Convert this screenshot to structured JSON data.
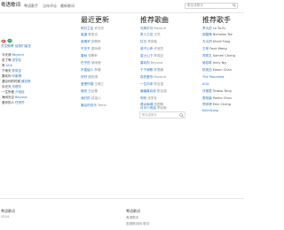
{
  "header": {
    "logo": "粤语歌词",
    "nav": [
      "粤语歌手",
      "当年评论",
      "最新歌词"
    ],
    "search_placeholder": "歌名或歌手"
  },
  "sidebar": {
    "links": [
      "关注微博",
      "给我们留言"
    ],
    "items": [
      {
        "song": "今天我",
        "artist": "Beyond"
      },
      {
        "song": "说了等",
        "artist": "张学友"
      },
      {
        "song": "有",
        "artist": "AGA"
      },
      {
        "song": "下雨天",
        "artist": "陈奕迅"
      },
      {
        "song": "喜欢你",
        "artist": "邓紫棋"
      },
      {
        "song": "遇见你的时候",
        "artist": "薛凯琪"
      },
      {
        "song": "月光光",
        "artist": "刘德华"
      },
      {
        "song": "一生所爱",
        "artist": "卢冠廷"
      },
      {
        "song": "海阔天空",
        "artist": "Beyond"
      },
      {
        "song": "爱你的人",
        "artist": "任贤齐"
      }
    ]
  },
  "latest": {
    "title": "最近更新",
    "items": [
      {
        "song": "明日之后",
        "artist": "许志安"
      },
      {
        "song": "高度",
        "artist": "陈奕迅"
      },
      {
        "song": "谁稀罕",
        "artist": "张敬轩"
      },
      {
        "song": "不在乎",
        "artist": "梁咏琪"
      },
      {
        "song": "春秋",
        "artist": "张敬轩"
      },
      {
        "song": "在乎的",
        "artist": "吴雨霏"
      },
      {
        "song": "不能缺少",
        "artist": "林峰"
      },
      {
        "song": "好好",
        "artist": "谢安琪"
      },
      {
        "song": "爱是怀疑",
        "artist": "王菀之"
      },
      {
        "song": "晚安",
        "artist": "古巨基"
      },
      {
        "song": "我们的",
        "artist": "容祖儿"
      },
      {
        "song": "最后的欢乐",
        "artist": "Twins"
      }
    ]
  },
  "recommend": {
    "title": "推荐歌曲",
    "items": [
      {
        "song": "光辉岁月",
        "artist": "Beyond"
      },
      {
        "song": "男人之苦",
        "artist": "王杰"
      },
      {
        "song": "红日",
        "artist": "李克勤"
      },
      {
        "song": "浪子心声",
        "artist": "许冠杰"
      },
      {
        "song": "富士山下",
        "artist": "陈奕迅"
      },
      {
        "song": "喜欢你",
        "artist": "Beyond"
      },
      {
        "song": "千千阙歌",
        "artist": "陈慧娴"
      },
      {
        "song": "真的爱你",
        "artist": "Beyond"
      },
      {
        "song": "一生何求",
        "artist": "陈百强"
      },
      {
        "song": "偏偏喜欢你",
        "artist": "陈百强"
      },
      {
        "song": "吻别",
        "artist": "张学友"
      },
      {
        "song": "倩女幽魂",
        "artist": "张国荣"
      },
      {
        "song": "月半小夜曲",
        "artist": "李克勤"
      }
    ],
    "cover_placeholder": "歌名或歌手"
  },
  "singers": {
    "title": "推荐歌手",
    "items": [
      {
        "name": "罗大佑",
        "en": "Lo Ta-Yu"
      },
      {
        "name": "谢霆锋",
        "en": "Nicholas Tse"
      },
      {
        "name": "方大同",
        "en": "Khalil Fong"
      },
      {
        "name": "王菲",
        "en": "Faye Wong"
      },
      {
        "name": "郑秀文",
        "en": "Sammi Cheng"
      },
      {
        "name": "吴若希",
        "en": "Jinny Ng"
      },
      {
        "name": "陈奕迅",
        "en": "Eason Chan"
      },
      {
        "name": "The Pancakes",
        "en": ""
      },
      {
        "name": "AGA",
        "en": ""
      },
      {
        "name": "邓丽君",
        "en": "Teresa Teng"
      },
      {
        "name": "周柏豪",
        "en": "Pakho Chau"
      },
      {
        "name": "郑伊健",
        "en": "Ekin Cheng"
      },
      {
        "name": "KillerSoap",
        "en": ""
      }
    ]
  },
  "footer": {
    "left_title": "粤语歌词",
    "left_sub": "2024",
    "right_title": "粤语歌词",
    "right_links": [
      "粤语歌手",
      "国语歌词网 歌词"
    ]
  }
}
